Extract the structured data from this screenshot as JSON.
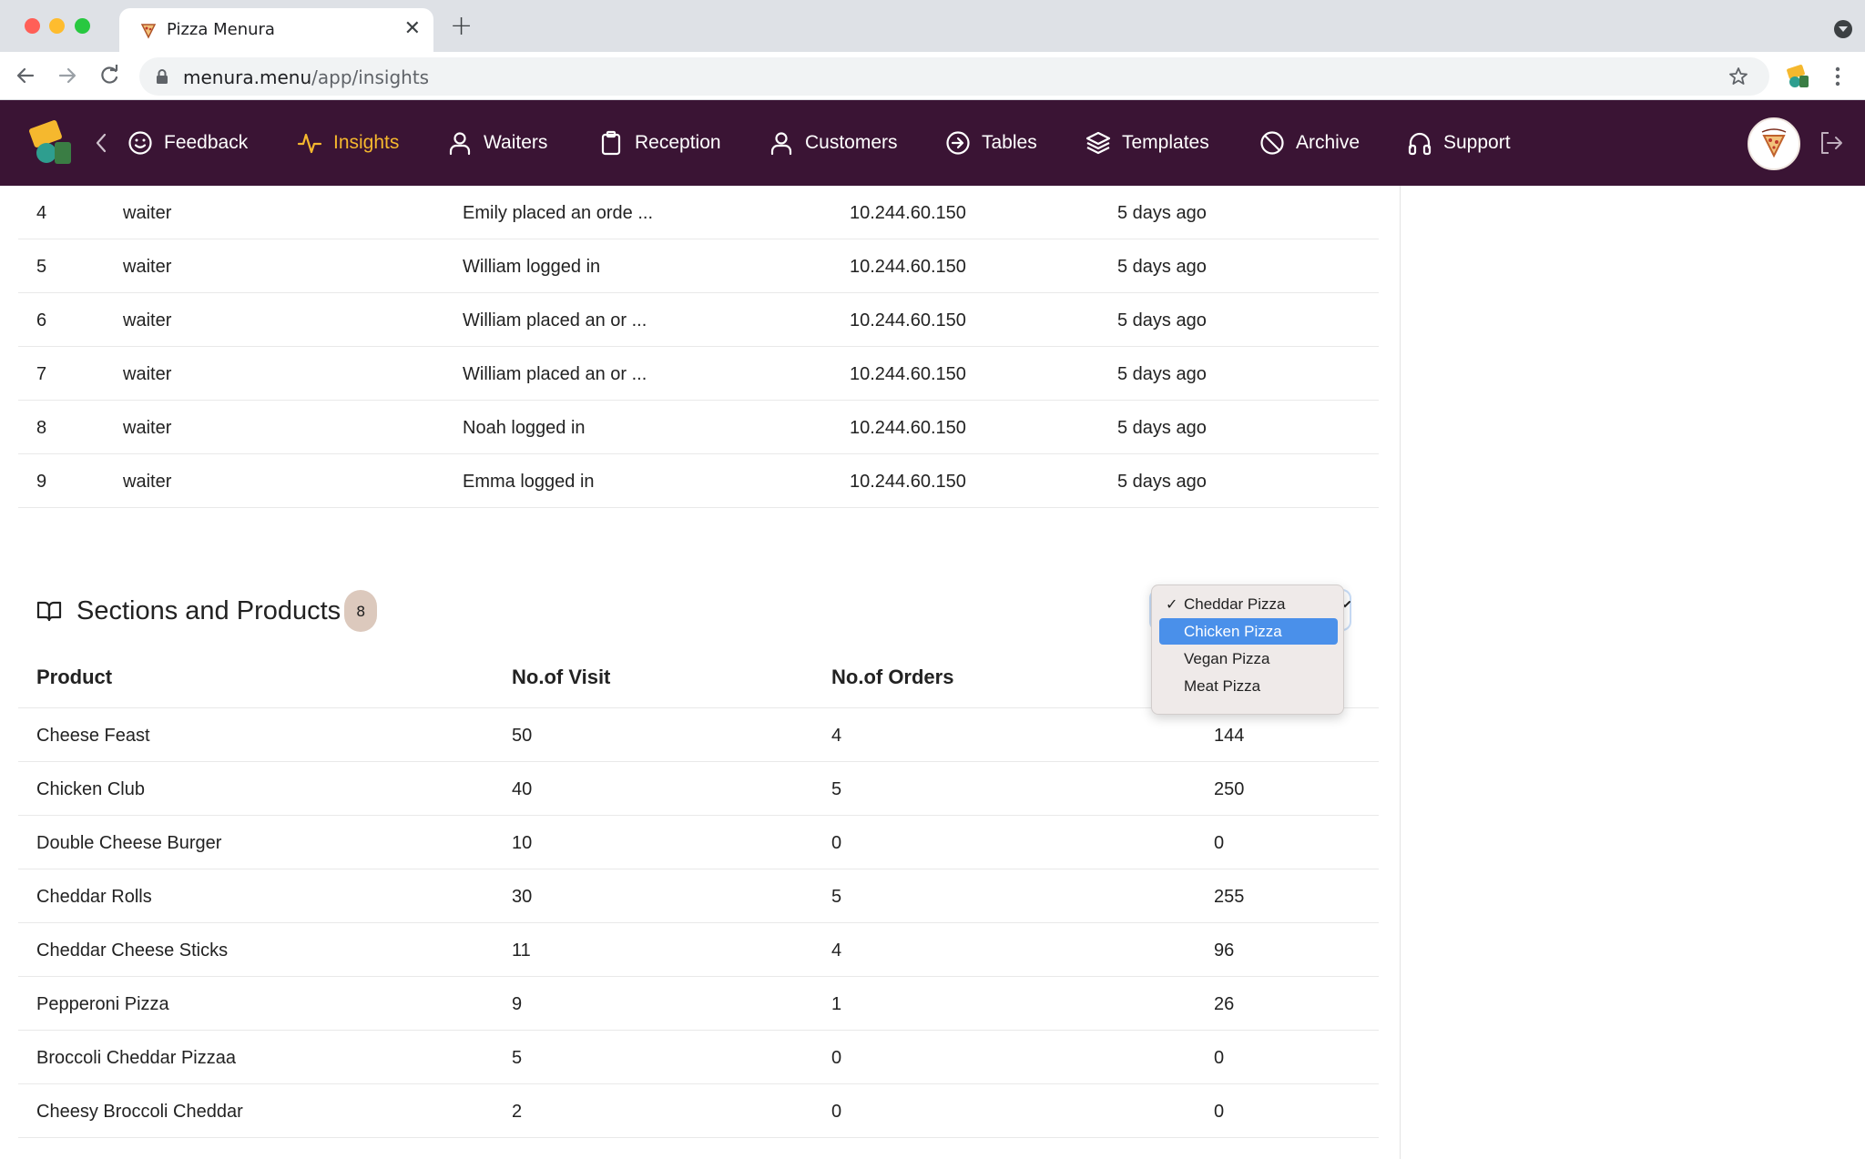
{
  "browser": {
    "tab_title": "Pizza Menura",
    "url_host": "menura.menu",
    "url_path": "/app/insights"
  },
  "nav": {
    "items": [
      {
        "label": "Feedback",
        "icon": "smile-icon"
      },
      {
        "label": "Insights",
        "icon": "activity-icon",
        "active": true
      },
      {
        "label": "Waiters",
        "icon": "user-icon"
      },
      {
        "label": "Reception",
        "icon": "clipboard-icon"
      },
      {
        "label": "Customers",
        "icon": "user-icon"
      },
      {
        "label": "Tables",
        "icon": "arrow-circle-icon"
      },
      {
        "label": "Templates",
        "icon": "layers-icon"
      },
      {
        "label": "Archive",
        "icon": "ban-icon"
      },
      {
        "label": "Support",
        "icon": "headphones-icon"
      }
    ],
    "active_color": "#f5b82e",
    "bar_color": "#3a1434"
  },
  "activity_log": {
    "rows": [
      {
        "num": "4",
        "role": "waiter",
        "action": "Emily placed an orde ...",
        "ip": "10.244.60.150",
        "time": "5 days ago"
      },
      {
        "num": "5",
        "role": "waiter",
        "action": "William logged in",
        "ip": "10.244.60.150",
        "time": "5 days ago"
      },
      {
        "num": "6",
        "role": "waiter",
        "action": "William placed an or ...",
        "ip": "10.244.60.150",
        "time": "5 days ago"
      },
      {
        "num": "7",
        "role": "waiter",
        "action": "William placed an or ...",
        "ip": "10.244.60.150",
        "time": "5 days ago"
      },
      {
        "num": "8",
        "role": "waiter",
        "action": "Noah logged in",
        "ip": "10.244.60.150",
        "time": "5 days ago"
      },
      {
        "num": "9",
        "role": "waiter",
        "action": "Emma logged in",
        "ip": "10.244.60.150",
        "time": "5 days ago"
      }
    ]
  },
  "products_section": {
    "title": "Sections and Products",
    "count": "8",
    "columns": [
      "Product",
      "No.of Visit",
      "No.of Orders"
    ],
    "rows": [
      {
        "name": "Cheese Feast",
        "visits": "50",
        "orders": "4",
        "revenue": "144"
      },
      {
        "name": "Chicken Club",
        "visits": "40",
        "orders": "5",
        "revenue": "250"
      },
      {
        "name": "Double Cheese Burger",
        "visits": "10",
        "orders": "0",
        "revenue": "0"
      },
      {
        "name": "Cheddar Rolls",
        "visits": "30",
        "orders": "5",
        "revenue": "255"
      },
      {
        "name": "Cheddar Cheese Sticks",
        "visits": "11",
        "orders": "4",
        "revenue": "96"
      },
      {
        "name": "Pepperoni Pizza",
        "visits": "9",
        "orders": "1",
        "revenue": "26"
      },
      {
        "name": "Broccoli Cheddar Pizzaa",
        "visits": "5",
        "orders": "0",
        "revenue": "0"
      },
      {
        "name": "Cheesy Broccoli Cheddar",
        "visits": "2",
        "orders": "0",
        "revenue": "0"
      }
    ],
    "dropdown": {
      "options": [
        "Cheddar Pizza",
        "Chicken Pizza",
        "Vegan Pizza",
        "Meat Pizza"
      ],
      "selected": "Cheddar Pizza",
      "highlighted": "Chicken Pizza",
      "check": "✓"
    }
  }
}
